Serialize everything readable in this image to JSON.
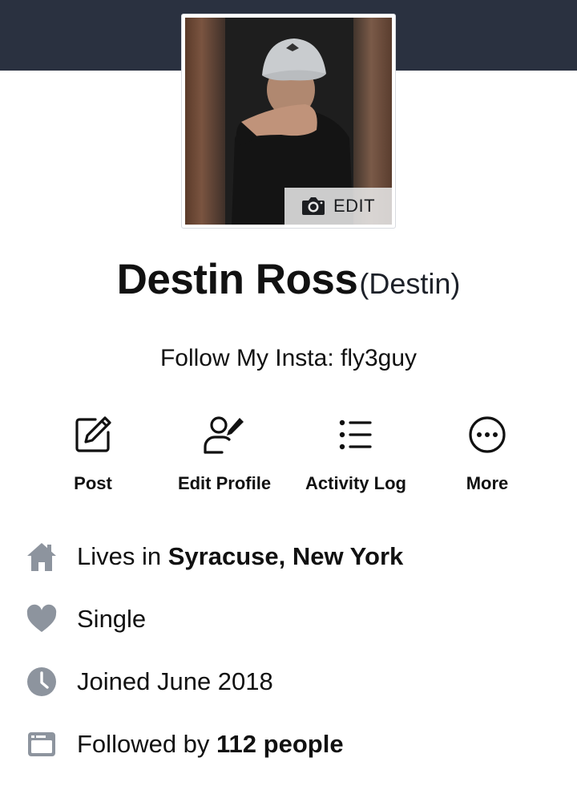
{
  "cover": {
    "color": "#2a3140"
  },
  "avatar": {
    "edit_label": "EDIT",
    "edit_icon": "camera-icon"
  },
  "profile": {
    "name": "Destin Ross",
    "alt_name": "(Destin)",
    "bio": "Follow My Insta: fly3guy"
  },
  "actions": [
    {
      "label": "Post",
      "icon": "compose-icon"
    },
    {
      "label": "Edit Profile",
      "icon": "person-edit-icon"
    },
    {
      "label": "Activity Log",
      "icon": "list-icon"
    },
    {
      "label": "More",
      "icon": "more-icon"
    }
  ],
  "info": {
    "lives": {
      "prefix": "Lives in ",
      "place": "Syracuse, New York",
      "icon": "home-icon"
    },
    "relationship": {
      "text": "Single",
      "icon": "heart-icon"
    },
    "joined": {
      "text": "Joined June 2018",
      "icon": "clock-icon"
    },
    "followers": {
      "prefix": "Followed by ",
      "count": "112 people",
      "icon": "followers-card-icon"
    }
  },
  "colors": {
    "icon_gray": "#8d949e",
    "text": "#111111"
  }
}
